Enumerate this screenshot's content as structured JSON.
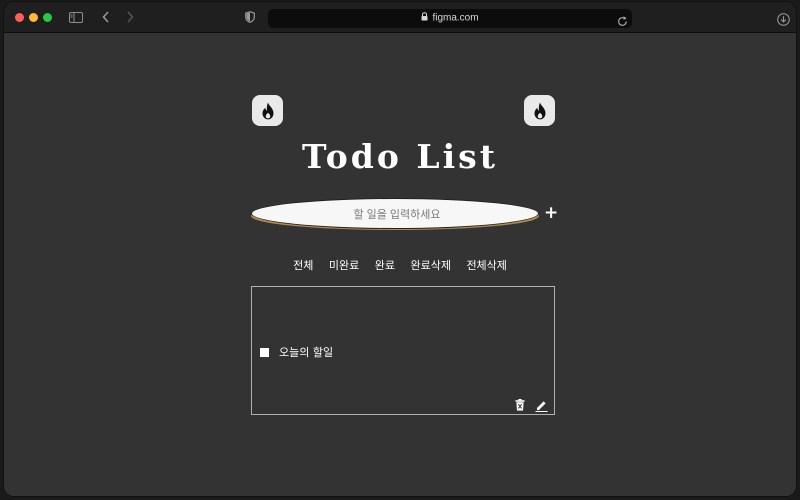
{
  "browser": {
    "url": "figma.com",
    "icons": [
      "sidebar-icon",
      "back-icon",
      "forward-icon",
      "shield-icon",
      "lock-icon",
      "reload-icon",
      "download-icon"
    ]
  },
  "app": {
    "title": "Todo List",
    "input": {
      "placeholder": "할 일을 입력하세요",
      "value": ""
    },
    "add_label": "+",
    "filters": [
      "전체",
      "미완료",
      "완료",
      "완료삭제",
      "전체삭제"
    ],
    "todos": [
      {
        "text": "오늘의 할일",
        "done": false
      }
    ],
    "icons": [
      "fire-icon",
      "trash-icon",
      "edit-icon"
    ]
  },
  "colors": {
    "background": "#333333",
    "titlebar": "#1f1f1f",
    "input_accent": "#b08a4a",
    "badge": "#e9e9e9"
  }
}
